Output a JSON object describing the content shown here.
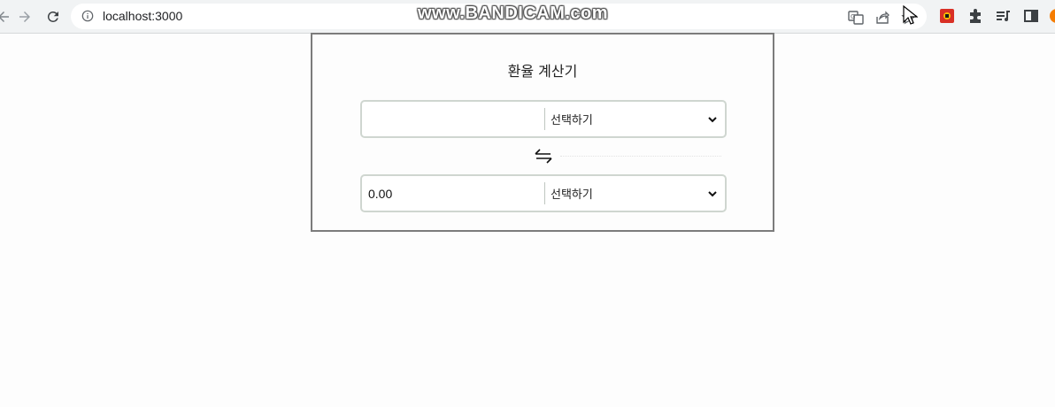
{
  "browser": {
    "url": "localhost:3000",
    "watermark": "www.BANDICAM.com"
  },
  "calculator": {
    "title": "환율 계산기",
    "from": {
      "amount_value": "",
      "currency_label": "선택하기"
    },
    "to": {
      "amount_value": "0.00",
      "currency_label": "선택하기"
    },
    "swap_icon": "swap-arrows-icon"
  },
  "colors": {
    "card_border": "#7c7c7c",
    "row_border": "#cfd6d0",
    "toolbar_bg": "#f1f3f4"
  }
}
